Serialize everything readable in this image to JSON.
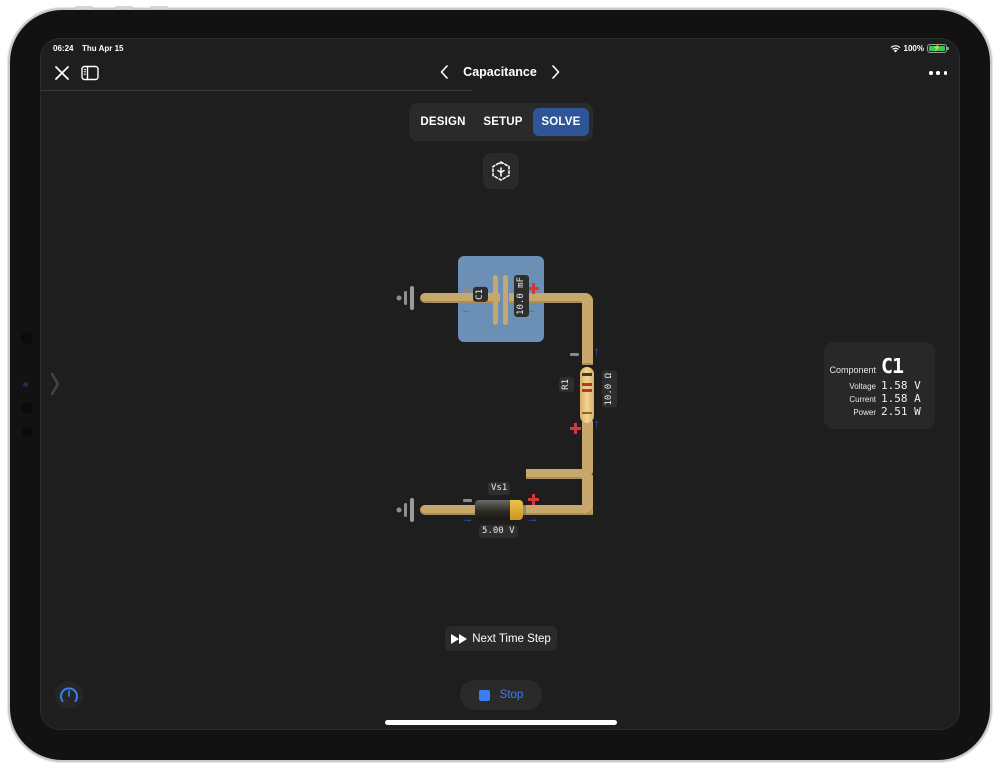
{
  "status_bar": {
    "time": "06:24",
    "date": "Thu Apr 15",
    "battery_percent": "100%",
    "wifi_icon": "wifi-icon",
    "battery_icon": "battery-charging-icon"
  },
  "nav": {
    "title": "Capacitance",
    "close_icon": "close-icon",
    "sidebar_icon": "sidebar-icon",
    "prev_icon": "chevron-left-icon",
    "next_icon": "chevron-right-icon",
    "more_icon": "more-icon"
  },
  "modes": {
    "items": [
      {
        "label": "DESIGN",
        "selected": false
      },
      {
        "label": "SETUP",
        "selected": false
      },
      {
        "label": "SOLVE",
        "selected": true
      }
    ],
    "accent": "#2e5597"
  },
  "recenter_icon": "recenter-cube-icon",
  "circuit": {
    "capacitor": {
      "name": "C1",
      "value": "10.0 mF",
      "selected": true,
      "highlight": "#6c8fb6"
    },
    "resistor": {
      "name": "R1",
      "value": "10.0 Ω"
    },
    "source": {
      "name": "Vs1",
      "value": "5.00 V"
    },
    "wire_color": "#c7a76b",
    "current_arrow_color": "#2f5fe0",
    "plus_color": "#d23a3a"
  },
  "info_panel": {
    "component_label": "Component",
    "component_value": "C1",
    "rows": [
      {
        "label": "Voltage",
        "value": "1.58 V"
      },
      {
        "label": "Current",
        "value": "1.58 A"
      },
      {
        "label": "Power",
        "value": "2.51 W"
      }
    ]
  },
  "controls": {
    "next_step_label": "Next Time Step",
    "stop_label": "Stop",
    "stop_color": "#3a7ff0"
  }
}
